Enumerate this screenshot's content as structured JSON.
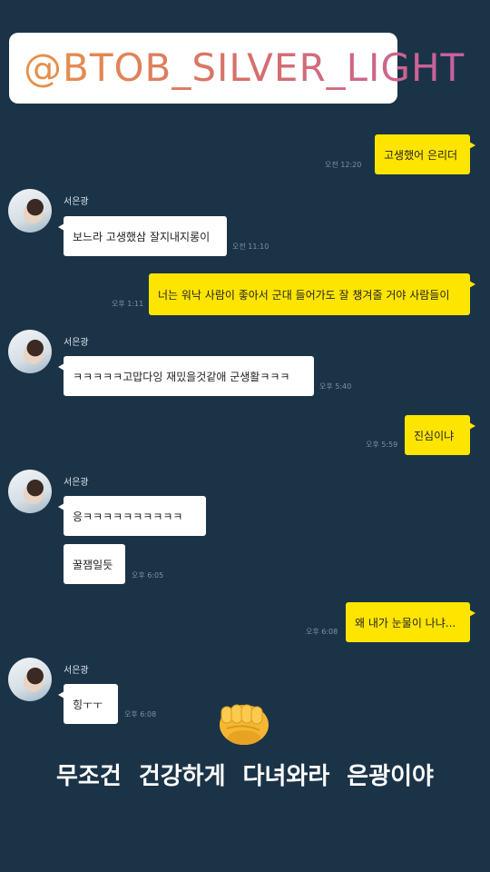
{
  "header": {
    "handle": "@BTOB_SILVER_LIGHT"
  },
  "contact": {
    "name": "서은광"
  },
  "messages": [
    {
      "side": "me",
      "text": "고생했어 은리더",
      "time": "오전 12:20"
    },
    {
      "side": "them",
      "text": "보느라 고생했삼 잘지내지롱이",
      "time": "오전 11:10"
    },
    {
      "side": "me",
      "text": "너는 워낙 사람이 좋아서 군대 들어가도 잘 챙겨줄 거야 사람들이",
      "time": "오후 1:11"
    },
    {
      "side": "them",
      "text": "ㅋㅋㅋㅋㅋ고맙다잉 재밌을것같애 군생활ㅋㅋㅋ",
      "time": "오후 5:40"
    },
    {
      "side": "me",
      "text": "진심이냐",
      "time": "오후 5:59"
    },
    {
      "side": "them",
      "text": "응ㅋㅋㅋㅋㅋㅋㅋㅋㅋㅋ",
      "time": ""
    },
    {
      "side": "them",
      "text": "꿀잼일듯",
      "time": "오후 6:05"
    },
    {
      "side": "me",
      "text": "왜 내가 눈물이 나냐...",
      "time": "오후 6:08"
    },
    {
      "side": "them",
      "text": "힝ㅜㅜ",
      "time": "오후 6:08"
    }
  ],
  "caption": "무조건 건강하게 다녀와라 은광이야",
  "emoji": {
    "name": "oncoming-fist",
    "glyph": "👊"
  }
}
